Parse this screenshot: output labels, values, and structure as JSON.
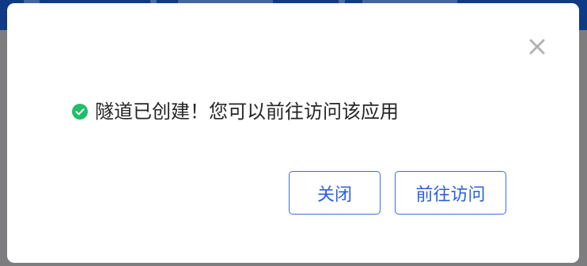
{
  "dialog": {
    "message": "隧道已创建！您可以前往访问该应用",
    "status_icon": "check-circle-icon",
    "close_icon": "close-icon",
    "buttons": {
      "close_label": "关闭",
      "goto_label": "前往访问"
    }
  },
  "colors": {
    "header_bg": "#0f3a85",
    "overlay": "#7d7d80",
    "success": "#1fbf6a",
    "button_primary_text": "#2b5fdc",
    "button_border": "#3d6ce0"
  }
}
